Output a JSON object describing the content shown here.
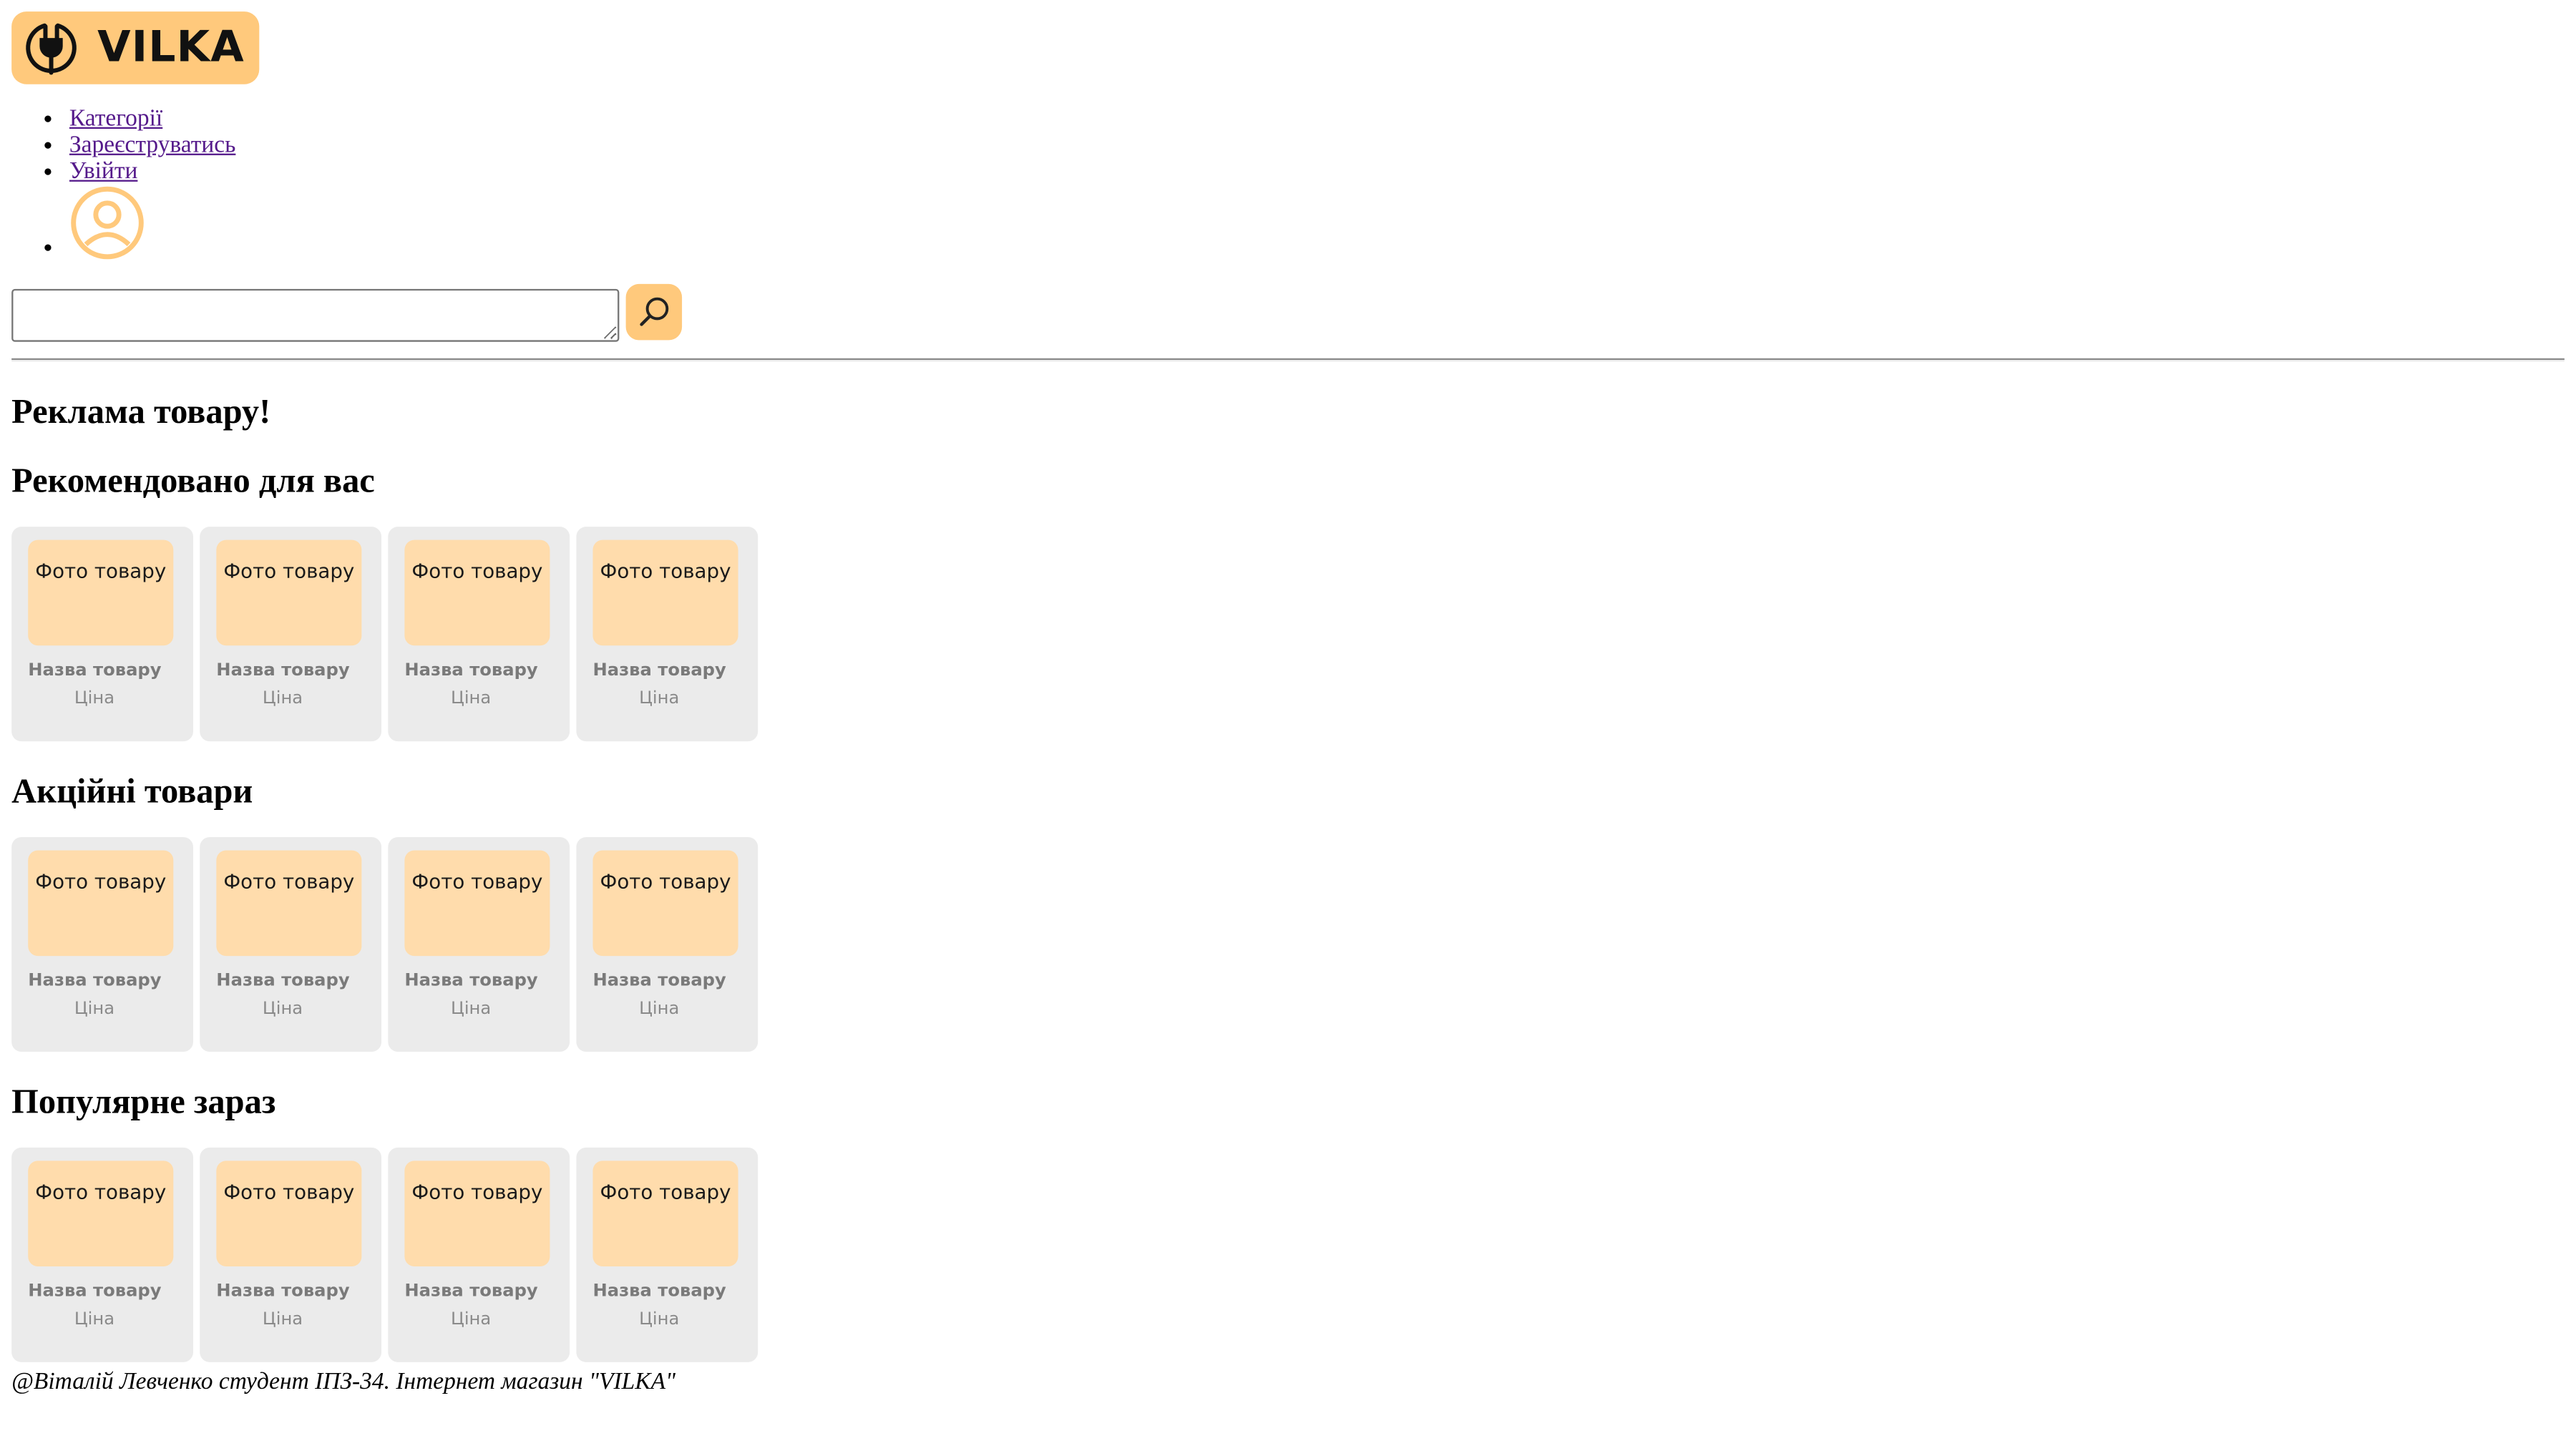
{
  "brand": {
    "name": "VILKA",
    "accent_color": "#ffc97c",
    "logo_icon": "plug-icon"
  },
  "nav": {
    "items": [
      {
        "label": "Категорії"
      },
      {
        "label": "Зареєструватись"
      },
      {
        "label": "Увійти"
      }
    ],
    "avatar_icon": "user-avatar-icon"
  },
  "search": {
    "value": "",
    "button_icon": "search-icon"
  },
  "hero": {
    "title": "Реклама товару!"
  },
  "sections": [
    {
      "title": "Рекомендовано для вас",
      "products": [
        {
          "photo": "Фото товару",
          "name": "Назва товару",
          "price": "Ціна"
        },
        {
          "photo": "Фото товару",
          "name": "Назва товару",
          "price": "Ціна"
        },
        {
          "photo": "Фото товару",
          "name": "Назва товару",
          "price": "Ціна"
        },
        {
          "photo": "Фото товару",
          "name": "Назва товару",
          "price": "Ціна"
        }
      ]
    },
    {
      "title": "Акційні товари",
      "products": [
        {
          "photo": "Фото товару",
          "name": "Назва товару",
          "price": "Ціна"
        },
        {
          "photo": "Фото товару",
          "name": "Назва товару",
          "price": "Ціна"
        },
        {
          "photo": "Фото товару",
          "name": "Назва товару",
          "price": "Ціна"
        },
        {
          "photo": "Фото товару",
          "name": "Назва товару",
          "price": "Ціна"
        }
      ]
    },
    {
      "title": "Популярне зараз",
      "products": [
        {
          "photo": "Фото товару",
          "name": "Назва товару",
          "price": "Ціна"
        },
        {
          "photo": "Фото товару",
          "name": "Назва товару",
          "price": "Ціна"
        },
        {
          "photo": "Фото товару",
          "name": "Назва товару",
          "price": "Ціна"
        },
        {
          "photo": "Фото товару",
          "name": "Назва товару",
          "price": "Ціна"
        }
      ]
    }
  ],
  "footer": {
    "text": "@Віталій Левченко студент ІПЗ-34. Інтернет магазин \"VILKA\""
  }
}
